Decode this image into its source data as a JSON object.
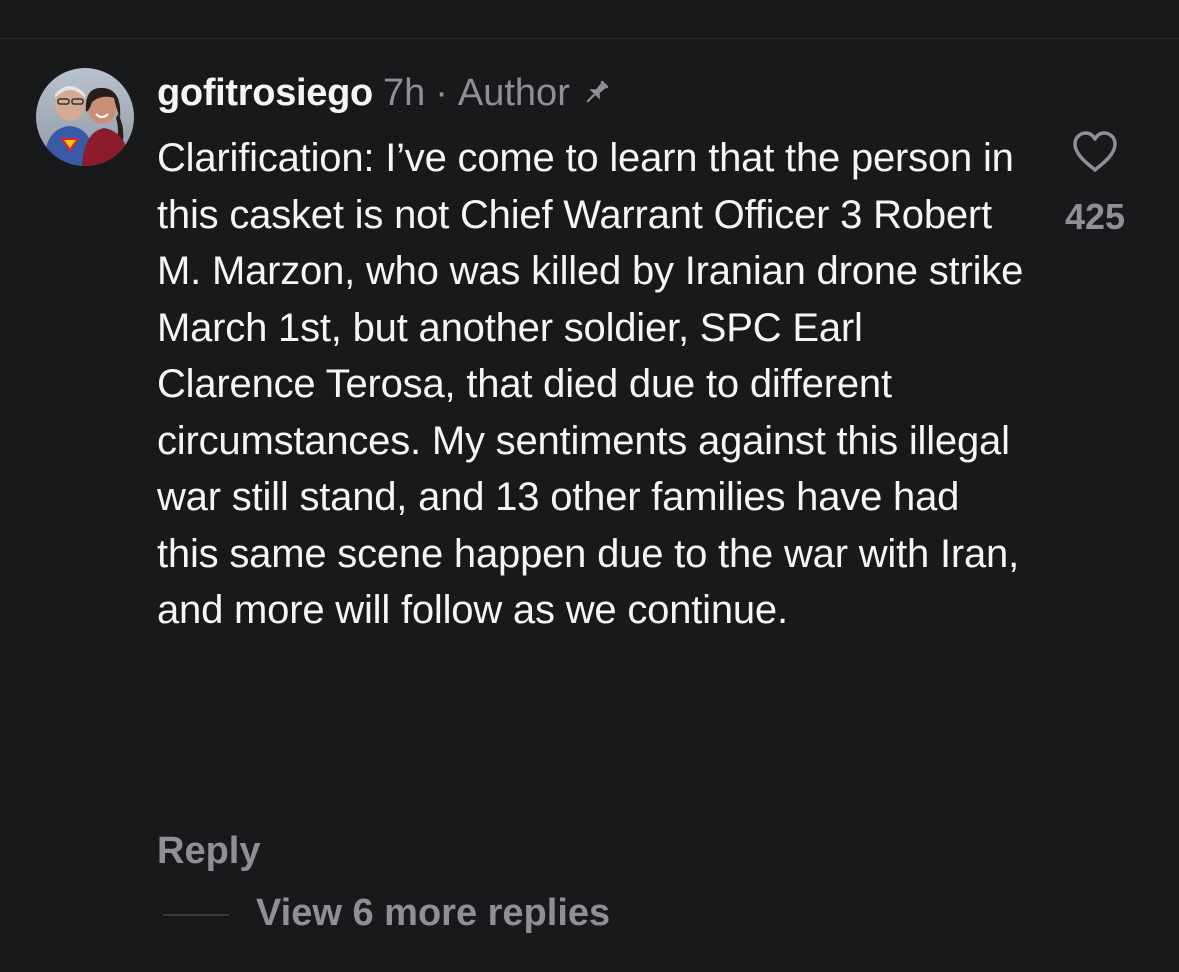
{
  "comment": {
    "username": "gofitrosiego",
    "timestamp": "7h",
    "separator": "·",
    "author_label": "Author",
    "pinned_icon": "pin-icon",
    "avatar_icon": "avatar",
    "body": "Clarification: I’ve come to learn that the person in this casket is not Chief Warrant Officer 3 Robert M. Marzon, who was killed by Iranian drone strike March 1st, but another soldier, SPC Earl Clarence Terosa, that died due to different circumstances. My sentiments against this illegal war still stand, and 13 other families have had this same scene happen due to the war with Iran, and more will follow as we continue.",
    "like_icon": "heart-icon",
    "like_count": "425",
    "reply_label": "Reply",
    "view_replies_label": "View 6 more replies"
  },
  "colors": {
    "background": "#18191b",
    "primary_text": "#f5f5f5",
    "secondary_text": "#8e9096"
  }
}
